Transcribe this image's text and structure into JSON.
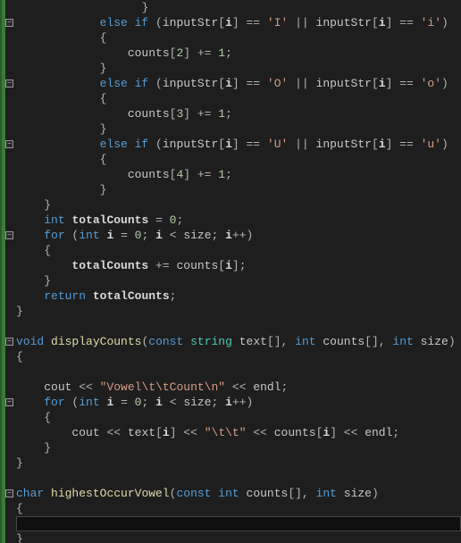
{
  "chart_data": null,
  "code": {
    "lines": [
      {
        "indent": 18,
        "tokens": [
          {
            "t": "}",
            "c": "op"
          }
        ]
      },
      {
        "fold": true,
        "indent": 12,
        "tokens": [
          {
            "t": "else if",
            "c": "kw"
          },
          {
            "t": " (",
            "c": "op"
          },
          {
            "t": "inputStr",
            "c": "var"
          },
          {
            "t": "[",
            "c": "op"
          },
          {
            "t": "i",
            "c": "hl"
          },
          {
            "t": "] == ",
            "c": "op"
          },
          {
            "t": "'I'",
            "c": "str"
          },
          {
            "t": " || ",
            "c": "op"
          },
          {
            "t": "inputStr",
            "c": "var"
          },
          {
            "t": "[",
            "c": "op"
          },
          {
            "t": "i",
            "c": "hl"
          },
          {
            "t": "] == ",
            "c": "op"
          },
          {
            "t": "'i'",
            "c": "str"
          },
          {
            "t": ")",
            "c": "op"
          }
        ]
      },
      {
        "indent": 12,
        "tokens": [
          {
            "t": "{",
            "c": "op"
          }
        ]
      },
      {
        "indent": 16,
        "tokens": [
          {
            "t": "counts",
            "c": "var"
          },
          {
            "t": "[",
            "c": "op"
          },
          {
            "t": "2",
            "c": "num"
          },
          {
            "t": "] += ",
            "c": "op"
          },
          {
            "t": "1",
            "c": "num"
          },
          {
            "t": ";",
            "c": "op"
          }
        ]
      },
      {
        "indent": 12,
        "tokens": [
          {
            "t": "}",
            "c": "op"
          }
        ]
      },
      {
        "fold": true,
        "indent": 12,
        "tokens": [
          {
            "t": "else if",
            "c": "kw"
          },
          {
            "t": " (",
            "c": "op"
          },
          {
            "t": "inputStr",
            "c": "var"
          },
          {
            "t": "[",
            "c": "op"
          },
          {
            "t": "i",
            "c": "hl"
          },
          {
            "t": "] == ",
            "c": "op"
          },
          {
            "t": "'O'",
            "c": "str"
          },
          {
            "t": " || ",
            "c": "op"
          },
          {
            "t": "inputStr",
            "c": "var"
          },
          {
            "t": "[",
            "c": "op"
          },
          {
            "t": "i",
            "c": "hl"
          },
          {
            "t": "] == ",
            "c": "op"
          },
          {
            "t": "'o'",
            "c": "str"
          },
          {
            "t": ")",
            "c": "op"
          }
        ]
      },
      {
        "indent": 12,
        "tokens": [
          {
            "t": "{",
            "c": "op"
          }
        ]
      },
      {
        "indent": 16,
        "tokens": [
          {
            "t": "counts",
            "c": "var"
          },
          {
            "t": "[",
            "c": "op"
          },
          {
            "t": "3",
            "c": "num"
          },
          {
            "t": "] += ",
            "c": "op"
          },
          {
            "t": "1",
            "c": "num"
          },
          {
            "t": ";",
            "c": "op"
          }
        ]
      },
      {
        "indent": 12,
        "tokens": [
          {
            "t": "}",
            "c": "op"
          }
        ]
      },
      {
        "fold": true,
        "indent": 12,
        "tokens": [
          {
            "t": "else if",
            "c": "kw"
          },
          {
            "t": " (",
            "c": "op"
          },
          {
            "t": "inputStr",
            "c": "var"
          },
          {
            "t": "[",
            "c": "op"
          },
          {
            "t": "i",
            "c": "hl"
          },
          {
            "t": "] == ",
            "c": "op"
          },
          {
            "t": "'U'",
            "c": "str"
          },
          {
            "t": " || ",
            "c": "op"
          },
          {
            "t": "inputStr",
            "c": "var"
          },
          {
            "t": "[",
            "c": "op"
          },
          {
            "t": "i",
            "c": "hl"
          },
          {
            "t": "] == ",
            "c": "op"
          },
          {
            "t": "'u'",
            "c": "str"
          },
          {
            "t": ")",
            "c": "op"
          }
        ]
      },
      {
        "indent": 12,
        "tokens": [
          {
            "t": "{",
            "c": "op"
          }
        ]
      },
      {
        "indent": 16,
        "tokens": [
          {
            "t": "counts",
            "c": "var"
          },
          {
            "t": "[",
            "c": "op"
          },
          {
            "t": "4",
            "c": "num"
          },
          {
            "t": "] += ",
            "c": "op"
          },
          {
            "t": "1",
            "c": "num"
          },
          {
            "t": ";",
            "c": "op"
          }
        ]
      },
      {
        "indent": 12,
        "tokens": [
          {
            "t": "}",
            "c": "op"
          }
        ]
      },
      {
        "indent": 4,
        "tokens": [
          {
            "t": "}",
            "c": "op"
          }
        ]
      },
      {
        "indent": 4,
        "tokens": [
          {
            "t": "int",
            "c": "typ"
          },
          {
            "t": " ",
            "c": "op"
          },
          {
            "t": "totalCounts",
            "c": "hl"
          },
          {
            "t": " = ",
            "c": "op"
          },
          {
            "t": "0",
            "c": "num"
          },
          {
            "t": ";",
            "c": "op"
          }
        ]
      },
      {
        "fold": true,
        "indent": 4,
        "tokens": [
          {
            "t": "for",
            "c": "kw"
          },
          {
            "t": " (",
            "c": "op"
          },
          {
            "t": "int",
            "c": "typ"
          },
          {
            "t": " ",
            "c": "op"
          },
          {
            "t": "i",
            "c": "hl"
          },
          {
            "t": " = ",
            "c": "op"
          },
          {
            "t": "0",
            "c": "num"
          },
          {
            "t": "; ",
            "c": "op"
          },
          {
            "t": "i",
            "c": "hl"
          },
          {
            "t": " < ",
            "c": "op"
          },
          {
            "t": "size",
            "c": "var"
          },
          {
            "t": "; ",
            "c": "op"
          },
          {
            "t": "i",
            "c": "hl"
          },
          {
            "t": "++)",
            "c": "op"
          }
        ]
      },
      {
        "indent": 4,
        "tokens": [
          {
            "t": "{",
            "c": "op"
          }
        ]
      },
      {
        "indent": 8,
        "tokens": [
          {
            "t": "totalCounts",
            "c": "hl"
          },
          {
            "t": " += ",
            "c": "op"
          },
          {
            "t": "counts",
            "c": "var"
          },
          {
            "t": "[",
            "c": "op"
          },
          {
            "t": "i",
            "c": "hl"
          },
          {
            "t": "];",
            "c": "op"
          }
        ]
      },
      {
        "indent": 4,
        "tokens": [
          {
            "t": "}",
            "c": "op"
          }
        ]
      },
      {
        "indent": 4,
        "tokens": [
          {
            "t": "return",
            "c": "kw"
          },
          {
            "t": " ",
            "c": "op"
          },
          {
            "t": "totalCounts",
            "c": "hl"
          },
          {
            "t": ";",
            "c": "op"
          }
        ]
      },
      {
        "indent": 0,
        "tokens": [
          {
            "t": "}",
            "c": "op"
          }
        ]
      },
      {
        "indent": 0,
        "tokens": []
      },
      {
        "fold": true,
        "indent": 0,
        "tokens": [
          {
            "t": "void",
            "c": "typ"
          },
          {
            "t": " ",
            "c": "op"
          },
          {
            "t": "displayCounts",
            "c": "fn"
          },
          {
            "t": "(",
            "c": "op"
          },
          {
            "t": "const",
            "c": "kw"
          },
          {
            "t": " ",
            "c": "op"
          },
          {
            "t": "string",
            "c": "cls"
          },
          {
            "t": " ",
            "c": "op"
          },
          {
            "t": "text",
            "c": "var"
          },
          {
            "t": "[], ",
            "c": "op"
          },
          {
            "t": "int",
            "c": "typ"
          },
          {
            "t": " ",
            "c": "op"
          },
          {
            "t": "counts",
            "c": "var"
          },
          {
            "t": "[], ",
            "c": "op"
          },
          {
            "t": "int",
            "c": "typ"
          },
          {
            "t": " ",
            "c": "op"
          },
          {
            "t": "size",
            "c": "var"
          },
          {
            "t": ")",
            "c": "op"
          }
        ]
      },
      {
        "indent": 0,
        "tokens": [
          {
            "t": "{",
            "c": "op"
          }
        ]
      },
      {
        "indent": 0,
        "tokens": []
      },
      {
        "indent": 4,
        "tokens": [
          {
            "t": "cout",
            "c": "var"
          },
          {
            "t": " << ",
            "c": "op"
          },
          {
            "t": "\"Vowel\\t\\tCount\\n\"",
            "c": "str"
          },
          {
            "t": " << ",
            "c": "op"
          },
          {
            "t": "endl",
            "c": "var"
          },
          {
            "t": ";",
            "c": "op"
          }
        ]
      },
      {
        "fold": true,
        "indent": 4,
        "tokens": [
          {
            "t": "for",
            "c": "kw"
          },
          {
            "t": " (",
            "c": "op"
          },
          {
            "t": "int",
            "c": "typ"
          },
          {
            "t": " ",
            "c": "op"
          },
          {
            "t": "i",
            "c": "hl"
          },
          {
            "t": " = ",
            "c": "op"
          },
          {
            "t": "0",
            "c": "num"
          },
          {
            "t": "; ",
            "c": "op"
          },
          {
            "t": "i",
            "c": "hl"
          },
          {
            "t": " < ",
            "c": "op"
          },
          {
            "t": "size",
            "c": "var"
          },
          {
            "t": "; ",
            "c": "op"
          },
          {
            "t": "i",
            "c": "hl"
          },
          {
            "t": "++)",
            "c": "op"
          }
        ]
      },
      {
        "indent": 4,
        "tokens": [
          {
            "t": "{",
            "c": "op"
          }
        ]
      },
      {
        "indent": 8,
        "tokens": [
          {
            "t": "cout",
            "c": "var"
          },
          {
            "t": " << ",
            "c": "op"
          },
          {
            "t": "text",
            "c": "var"
          },
          {
            "t": "[",
            "c": "op"
          },
          {
            "t": "i",
            "c": "hl"
          },
          {
            "t": "] << ",
            "c": "op"
          },
          {
            "t": "\"\\t\\t\"",
            "c": "str"
          },
          {
            "t": " << ",
            "c": "op"
          },
          {
            "t": "counts",
            "c": "var"
          },
          {
            "t": "[",
            "c": "op"
          },
          {
            "t": "i",
            "c": "hl"
          },
          {
            "t": "] << ",
            "c": "op"
          },
          {
            "t": "endl",
            "c": "var"
          },
          {
            "t": ";",
            "c": "op"
          }
        ]
      },
      {
        "indent": 4,
        "tokens": [
          {
            "t": "}",
            "c": "op"
          }
        ]
      },
      {
        "indent": 0,
        "tokens": [
          {
            "t": "}",
            "c": "op"
          }
        ]
      },
      {
        "indent": 0,
        "tokens": []
      },
      {
        "fold": true,
        "indent": 0,
        "tokens": [
          {
            "t": "char",
            "c": "typ"
          },
          {
            "t": " ",
            "c": "op"
          },
          {
            "t": "highestOccurVowel",
            "c": "fn"
          },
          {
            "t": "(",
            "c": "op"
          },
          {
            "t": "const",
            "c": "kw"
          },
          {
            "t": " ",
            "c": "op"
          },
          {
            "t": "int",
            "c": "typ"
          },
          {
            "t": " ",
            "c": "op"
          },
          {
            "t": "counts",
            "c": "var"
          },
          {
            "t": "[], ",
            "c": "op"
          },
          {
            "t": "int",
            "c": "typ"
          },
          {
            "t": " ",
            "c": "op"
          },
          {
            "t": "size",
            "c": "var"
          },
          {
            "t": ")",
            "c": "op"
          }
        ]
      },
      {
        "indent": 0,
        "tokens": [
          {
            "t": "{",
            "c": "op"
          }
        ]
      },
      {
        "cursor": true,
        "indent": 0,
        "tokens": []
      },
      {
        "indent": 0,
        "tokens": [
          {
            "t": "}",
            "c": "op"
          }
        ]
      }
    ]
  }
}
